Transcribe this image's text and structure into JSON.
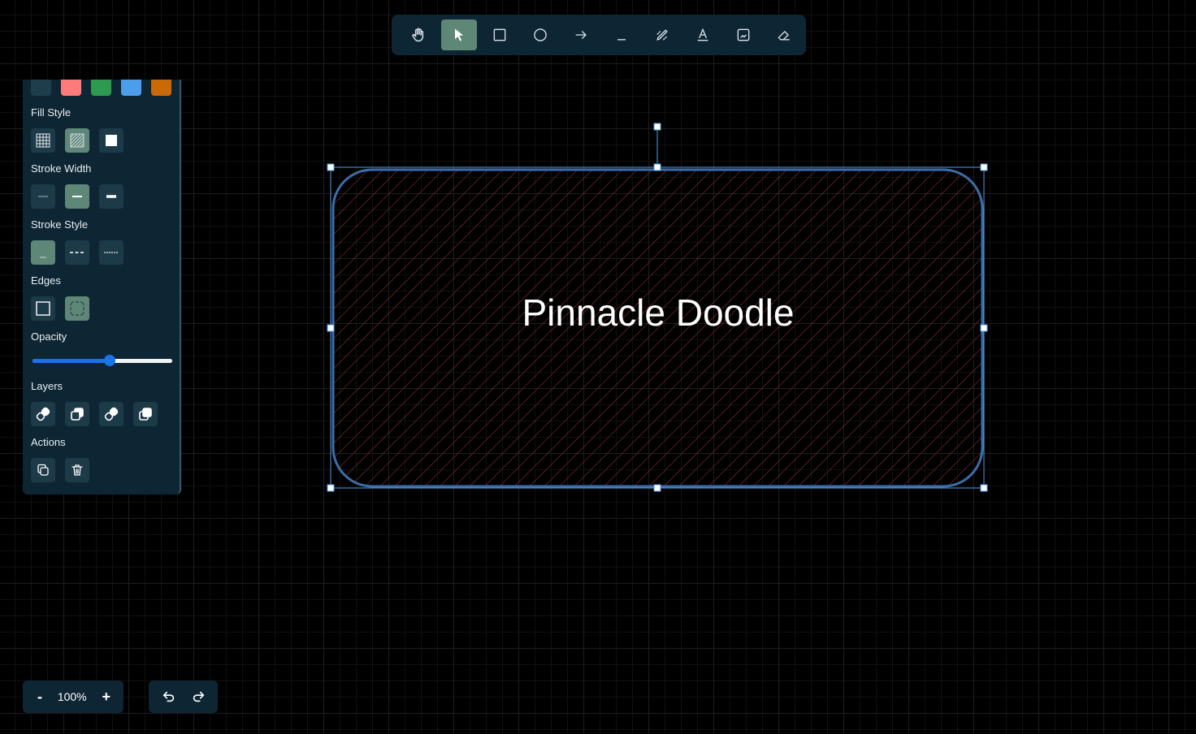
{
  "toolbar": {
    "tools": [
      {
        "name": "hand-icon",
        "active": false
      },
      {
        "name": "select-cursor-icon",
        "active": true
      },
      {
        "name": "rectangle-icon",
        "active": false
      },
      {
        "name": "ellipse-icon",
        "active": false
      },
      {
        "name": "arrow-icon",
        "active": false
      },
      {
        "name": "line-icon",
        "active": false
      },
      {
        "name": "pencil-icon",
        "active": false
      },
      {
        "name": "text-icon",
        "active": false
      },
      {
        "name": "image-icon",
        "active": false
      },
      {
        "name": "eraser-icon",
        "active": false
      }
    ]
  },
  "panel": {
    "colors": [
      "#1f3e4b",
      "#ff7b7b",
      "#2e9a4f",
      "#4c9eea",
      "#c96a06"
    ],
    "fill_style": {
      "label": "Fill Style",
      "options": [
        "cross-hatch",
        "hachure",
        "solid"
      ],
      "selected": "hachure"
    },
    "stroke_width": {
      "label": "Stroke Width",
      "options": [
        "thin",
        "medium",
        "bold"
      ],
      "selected": "medium"
    },
    "stroke_style": {
      "label": "Stroke Style",
      "options": [
        "solid",
        "dashed",
        "dotted"
      ],
      "selected": "solid"
    },
    "edges": {
      "label": "Edges",
      "options": [
        "sharp",
        "round"
      ],
      "selected": "round"
    },
    "opacity": {
      "label": "Opacity",
      "value": 0.55
    },
    "layers": {
      "label": "Layers",
      "options": [
        "send-to-back",
        "send-backward",
        "bring-forward",
        "bring-to-front"
      ]
    },
    "actions": {
      "label": "Actions",
      "options": [
        "duplicate",
        "delete"
      ]
    }
  },
  "canvas": {
    "shape_text": "Pinnacle Doodle",
    "stroke_color": "#3d6da8",
    "hatch_color": "#8a3030"
  },
  "footer": {
    "zoom_out": "-",
    "zoom_value": "100%",
    "zoom_in": "+"
  }
}
